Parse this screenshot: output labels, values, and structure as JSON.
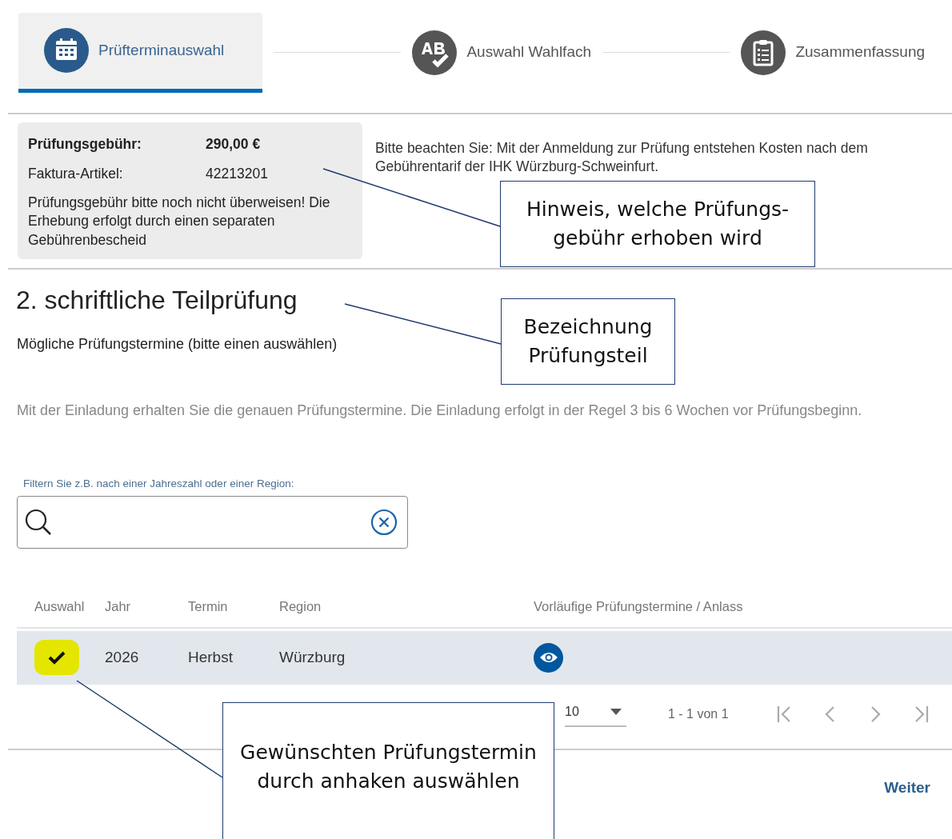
{
  "steps": [
    {
      "label": "Prüfterminauswahl",
      "selected": true
    },
    {
      "label": "Auswahl Wahlfach",
      "selected": false
    },
    {
      "label": "Zusammenfassung",
      "selected": false
    }
  ],
  "fee": {
    "rows": [
      {
        "label": "Prüfungsgebühr:",
        "value": "290,00 €",
        "emphasized": true
      },
      {
        "label": "Faktura-Artikel:",
        "value": "42213201",
        "emphasized": false
      }
    ],
    "note": "Prüfungsgebühr bitte noch nicht überweisen! Die Erhebung erfolgt durch einen separaten Gebührenbescheid"
  },
  "notice": "Bitte beachten Sie: Mit der Anmeldung zur Prüfung entstehen Kosten nach dem Gebührentarif der IHK Würzburg-Schweinfurt.",
  "section": {
    "heading": "2. schriftliche Teilprüfung",
    "subtitle": "Mögliche Prüfungstermine (bitte einen auswählen)",
    "info": "Mit der Einladung erhalten Sie die genauen Prüfungstermine. Die Einladung erfolgt in der Regel 3 bis 6 Wochen vor Prüfungsbeginn."
  },
  "filter": {
    "label": "Filtern Sie z.B. nach einer Jahreszahl oder einer Region:"
  },
  "table": {
    "columns": [
      "Auswahl",
      "Jahr",
      "Termin",
      "Region",
      "Vorläufige Prüfungstermine / Anlass"
    ],
    "rows": [
      {
        "selected": true,
        "highlighted": true,
        "cells": [
          "",
          "2026",
          "Herbst",
          "Würzburg",
          ""
        ]
      }
    ]
  },
  "pagination": {
    "page_size": "10",
    "range": "1 - 1 von 1"
  },
  "next_button": "Weiter",
  "callouts": [
    {
      "lines": [
        "Hinweis, welche Prüfungs-",
        "gebühr erhoben wird"
      ]
    },
    {
      "lines": [
        "Bezeichnung",
        "Prüfungsteil"
      ]
    },
    {
      "lines": [
        "Gewünschten Prüfungstermin",
        "durch anhaken auswählen"
      ]
    }
  ]
}
